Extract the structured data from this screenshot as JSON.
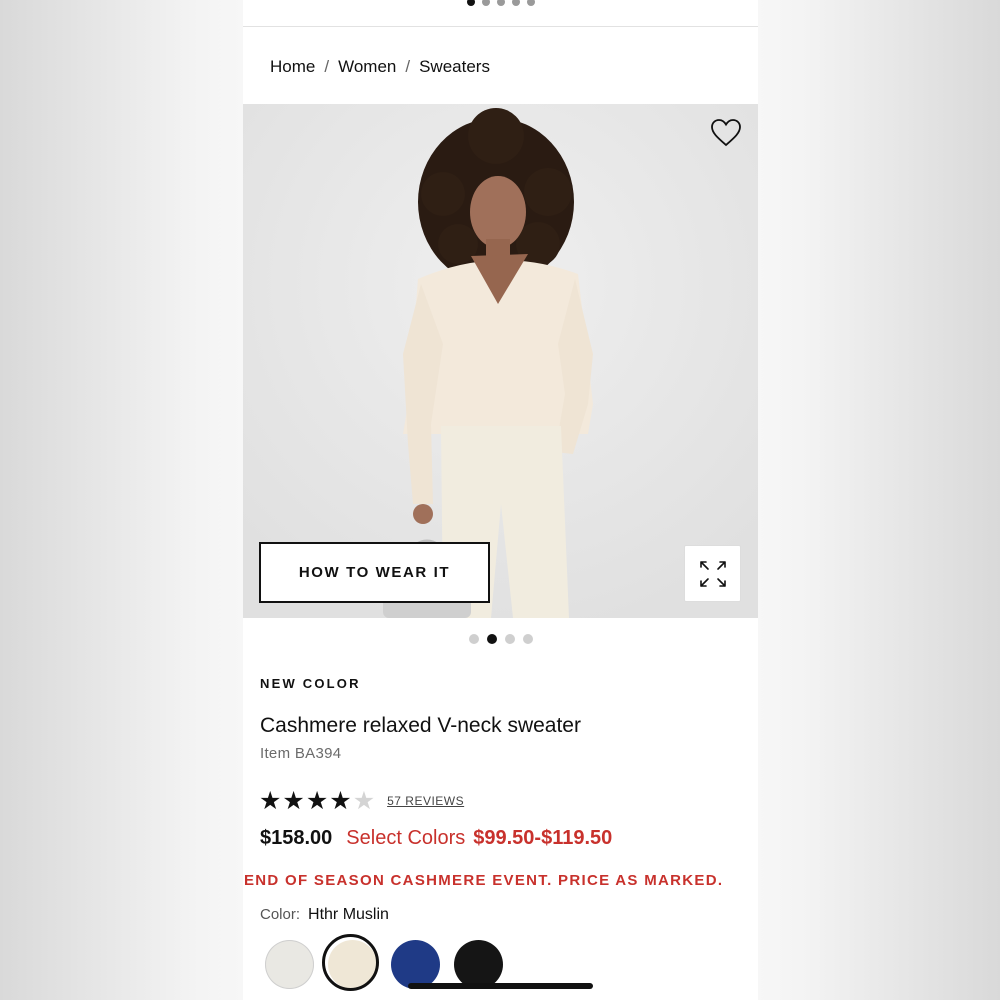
{
  "breadcrumb": {
    "home": "Home",
    "women": "Women",
    "sweaters": "Sweaters",
    "separator": "/"
  },
  "hero": {
    "how_to_wear_label": "HOW TO WEAR IT",
    "carousel_total": 4,
    "carousel_active": 2,
    "icons": {
      "favorite": "heart-icon",
      "expand": "expand-icon"
    }
  },
  "product": {
    "badge": "NEW COLOR",
    "title": "Cashmere relaxed V-neck sweater",
    "item_number": "Item BA394",
    "rating_value": 4,
    "rating_max": 5,
    "reviews_label": "57 REVIEWS",
    "price_original": "$158.00",
    "price_select_label": "Select Colors",
    "price_sale_range": "$99.50-$119.50",
    "promo": "END OF SEASON CASHMERE EVENT. PRICE AS MARKED.",
    "color_label": "Color:",
    "color_value": "Hthr Muslin",
    "swatches": [
      {
        "color": "#e9e8e3",
        "selected": false
      },
      {
        "color": "#efe7d6",
        "selected": true
      },
      {
        "color": "#1f3a86",
        "selected": false
      },
      {
        "color": "#151515",
        "selected": false
      }
    ]
  },
  "colors": {
    "sale_red": "#c8312c",
    "text": "#111111"
  }
}
